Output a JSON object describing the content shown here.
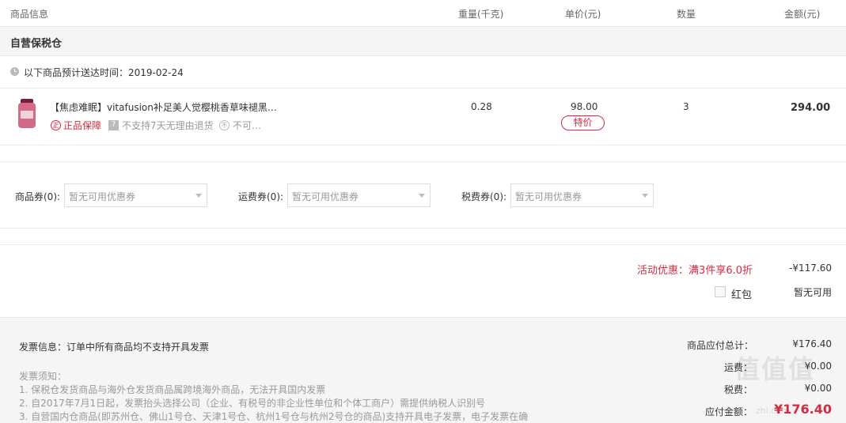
{
  "header": {
    "col_product": "商品信息",
    "col_weight": "重量(千克)",
    "col_price": "单价(元)",
    "col_qty": "数量",
    "col_amount": "金额(元)"
  },
  "warehouse": {
    "name": "自营保税仓"
  },
  "delivery": {
    "text": "以下商品预计送达时间：2019-02-24"
  },
  "product": {
    "name": "【焦虑难眠】vitafusion补足美人觉樱桃香草味褪黑…",
    "genuine_badge": "正品保障",
    "genuine_icon_text": "正",
    "noreturn_icon_text": "7",
    "noreturn_text": "不支持7天无理由退货",
    "third_badge": "不可…",
    "third_icon_text": "不",
    "weight": "0.28",
    "price": "98.00",
    "special_tag": "特价",
    "qty": "3",
    "amount": "294.00"
  },
  "coupons": [
    {
      "label": "商品券(0):",
      "value": "暂无可用优惠券"
    },
    {
      "label": "运费券(0):",
      "value": "暂无可用优惠券"
    },
    {
      "label": "税费券(0):",
      "value": "暂无可用优惠券"
    }
  ],
  "discount": {
    "promo_label": "活动优惠：满3件享6.0折",
    "promo_value": "-¥117.60",
    "redpacket_label": "红包",
    "redpacket_value": "暂无可用"
  },
  "invoice": {
    "title": "发票信息：订单中所有商品均不支持开具发票",
    "notes_title": "发票须知：",
    "notes": [
      "1. 保税仓发货商品与海外仓发货商品属跨境海外商品，无法开具国内发票",
      "2. 自2017年7月1日起，发票抬头选择公司（企业、有税号的非企业性单位和个体工商户）需提供纳税人识别号",
      "3. 自营国内仓商品(即苏州仓、佛山1号仓、天津1号仓、杭州1号仓与杭州2号仓的商品)支持开具电子发票，电子发票在确"
    ]
  },
  "summary": {
    "goods_total_label": "商品应付总计：",
    "goods_total_value": "¥176.40",
    "shipping_label": "运费：",
    "shipping_value": "¥0.00",
    "tax_label": "税费：",
    "tax_value": "¥0.00",
    "payable_label": "应付金额：",
    "payable_value": "¥176.40"
  },
  "watermark": {
    "text": "值值值",
    "url": "zhi.com"
  },
  "colors": {
    "accent": "#d42a40",
    "muted": "#999999",
    "panel": "#f5f5f5"
  }
}
